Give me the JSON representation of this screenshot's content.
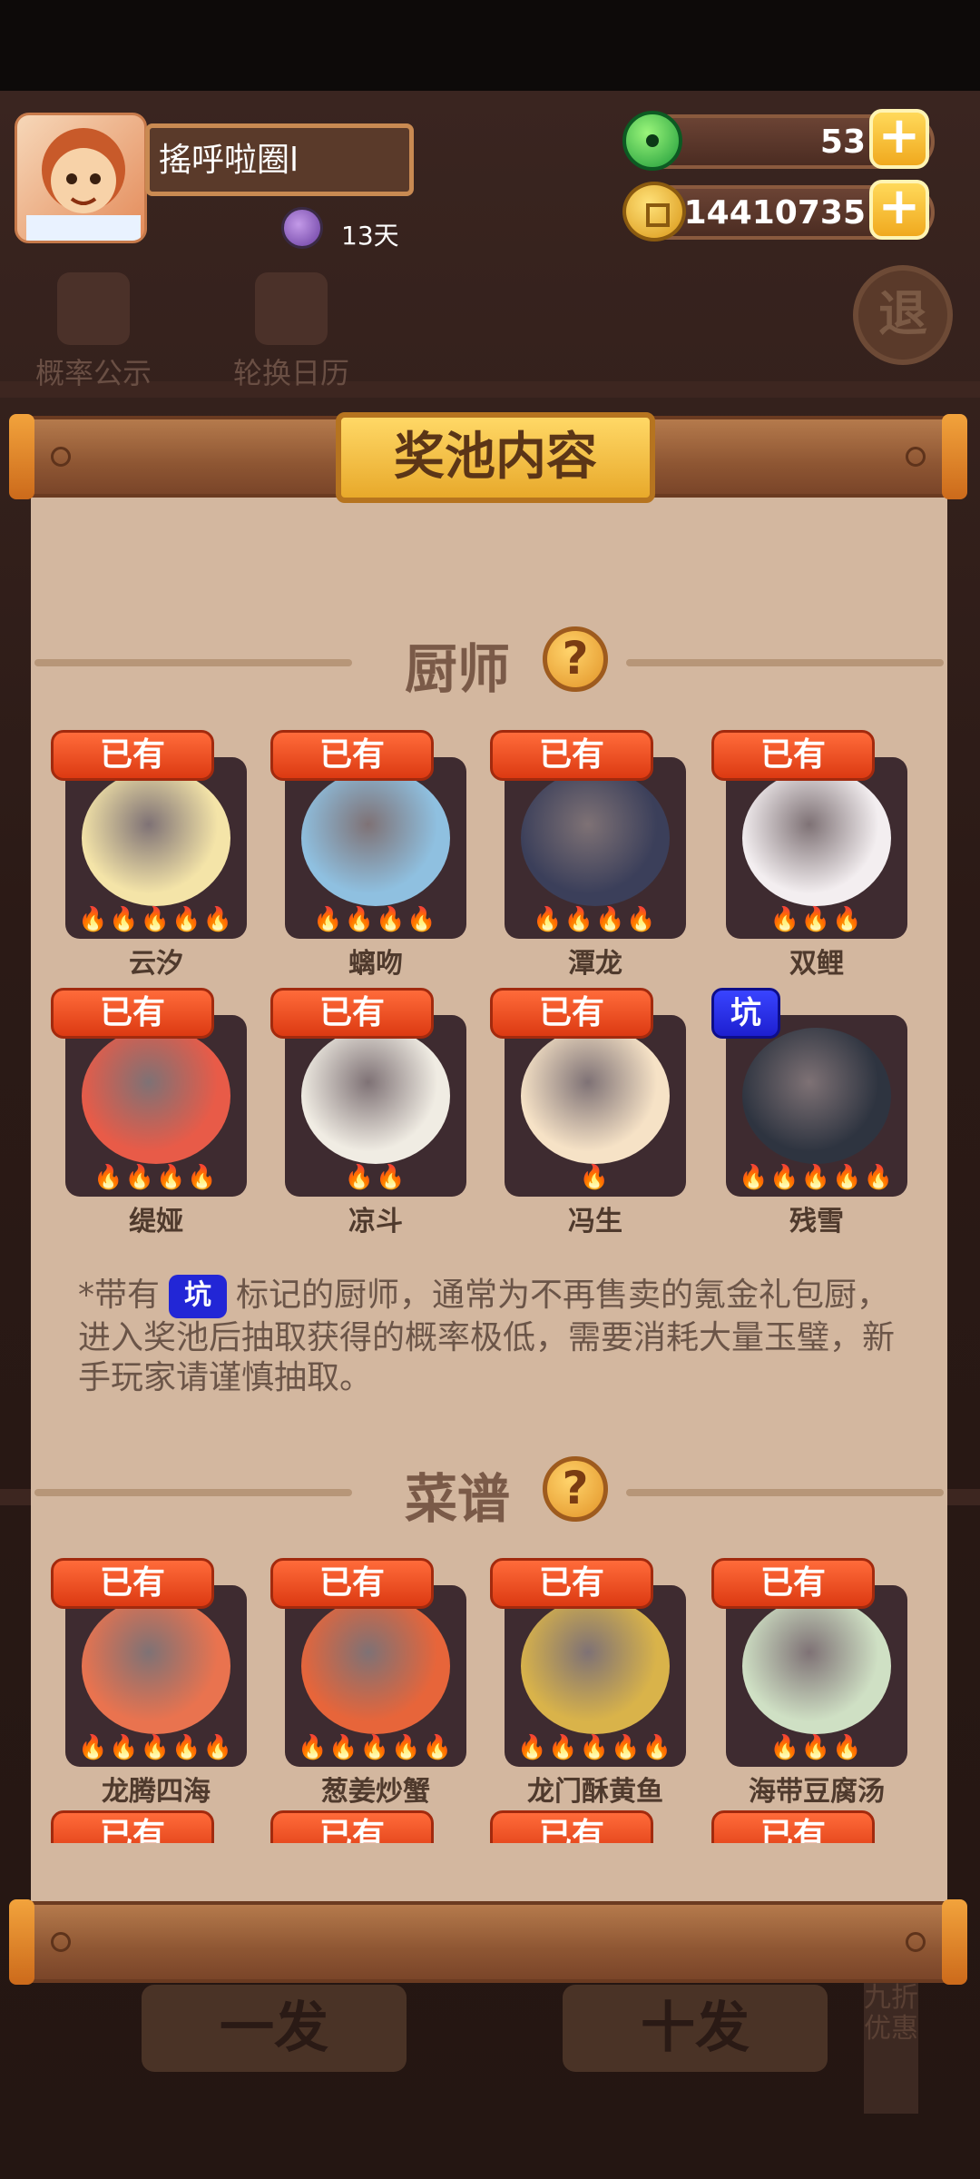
{
  "player": {
    "name": "搖呼啦圈l",
    "online_days": "13天"
  },
  "resources": {
    "jade": "53",
    "coins": "14410735"
  },
  "tools": {
    "probability_label": "概率公示",
    "calendar_label": "轮换日历",
    "exit_label": "退"
  },
  "bottom_buttons": {
    "single": "一发",
    "ten": "十发",
    "discount": "九折优惠"
  },
  "modal": {
    "title": "奖池内容",
    "chefs_section": {
      "heading": "厨师",
      "items": [
        {
          "name": "云汐",
          "badge": "已有",
          "stars": 5,
          "art_color": "#f4e4a8"
        },
        {
          "name": "螭吻",
          "badge": "已有",
          "stars": 4,
          "art_color": "#8fc0e0"
        },
        {
          "name": "潭龙",
          "badge": "已有",
          "stars": 4,
          "art_color": "#3b3f5a"
        },
        {
          "name": "双鲤",
          "badge": "已有",
          "stars": 3,
          "art_color": "#f3eef0"
        },
        {
          "name": "缇娅",
          "badge": "已有",
          "stars": 4,
          "art_color": "#e85b48"
        },
        {
          "name": "凉斗",
          "badge": "已有",
          "stars": 2,
          "art_color": "#f0ece3"
        },
        {
          "name": "冯生",
          "badge": "已有",
          "stars": 1,
          "art_color": "#f6e2c6"
        },
        {
          "name": "残雪",
          "badge": "坑",
          "stars": 5,
          "art_color": "#2e3440"
        }
      ]
    },
    "note": {
      "prefix": "*带有",
      "pit_label": "坑",
      "text": "标记的厨师，通常为不再售卖的氪金礼包厨，进入奖池后抽取获得的概率极低，需要消耗大量玉璧，新手玩家请谨慎抽取。"
    },
    "recipes_section": {
      "heading": "菜谱",
      "items": [
        {
          "name": "龙腾四海",
          "badge": "已有",
          "stars": 5,
          "art_color": "#e9734f"
        },
        {
          "name": "葱姜炒蟹",
          "badge": "已有",
          "stars": 5,
          "art_color": "#e7653a"
        },
        {
          "name": "龙门酥黄鱼",
          "badge": "已有",
          "stars": 5,
          "art_color": "#d9b34a"
        },
        {
          "name": "海带豆腐汤",
          "badge": "已有",
          "stars": 3,
          "art_color": "#cfe0c4"
        }
      ],
      "next_row_badges": [
        "已有",
        "已有",
        "已有",
        "已有"
      ]
    }
  }
}
